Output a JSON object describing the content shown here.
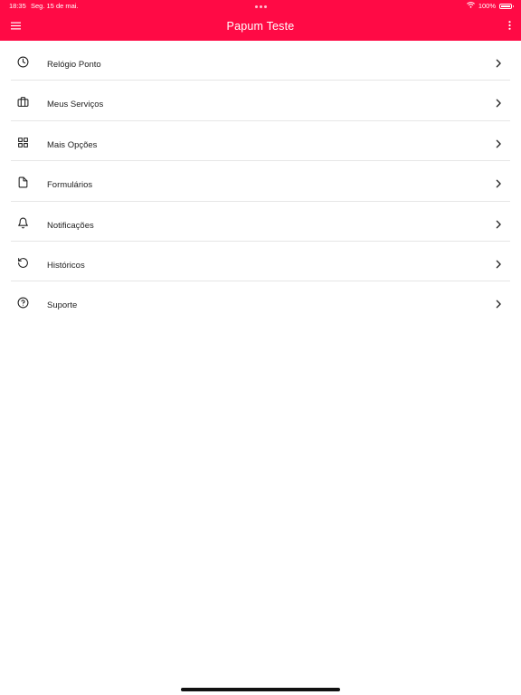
{
  "theme": {
    "accent": "#ff0a45",
    "background": "#ffffff",
    "text": "#222222",
    "divider": "#e6e6e6"
  },
  "status_bar": {
    "time": "18:35",
    "date": "Seg. 15 de mai.",
    "battery_text": "100%",
    "battery_level": 1.0,
    "wifi_icon": "wifi-icon"
  },
  "app_bar": {
    "title": "Papum Teste",
    "menu_icon": "hamburger-menu-icon",
    "more_icon": "more-vertical-icon"
  },
  "menu": {
    "items": [
      {
        "id": "relogio-ponto",
        "label": "Relógio Ponto",
        "icon": "clock-icon"
      },
      {
        "id": "meus-servicos",
        "label": "Meus Serviços",
        "icon": "briefcase-icon"
      },
      {
        "id": "mais-opcoes",
        "label": "Mais Opções",
        "icon": "grid-icon"
      },
      {
        "id": "formularios",
        "label": "Formulários",
        "icon": "file-icon"
      },
      {
        "id": "notificacoes",
        "label": "Notificações",
        "icon": "bell-icon"
      },
      {
        "id": "historicos",
        "label": "Históricos",
        "icon": "history-icon"
      },
      {
        "id": "suporte",
        "label": "Suporte",
        "icon": "help-circle-icon"
      }
    ],
    "chevron_icon": "chevron-right-icon"
  }
}
